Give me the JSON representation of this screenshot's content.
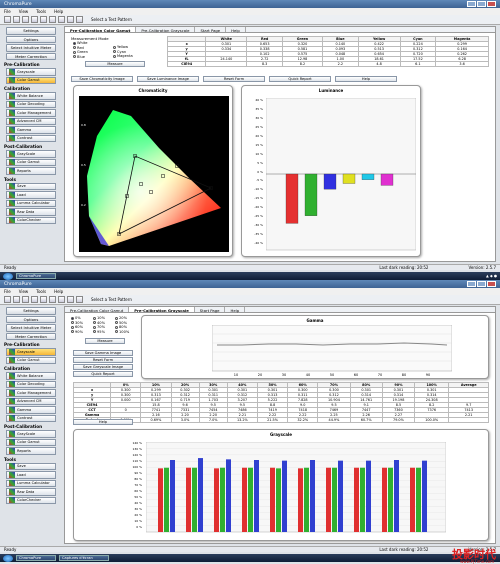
{
  "app_title": "ChromaPure",
  "menu": [
    "File",
    "View",
    "Tools",
    "Help"
  ],
  "test_pattern_label": "Select a Test Pattern",
  "sidebar": {
    "top_buttons": [
      "Settings",
      "Options",
      "Select Intuitive Meter",
      "Meter Correction"
    ],
    "sections": [
      {
        "head": "Pre-Calibration",
        "items": [
          "Grayscale",
          "Color Gamut"
        ]
      },
      {
        "head": "Calibration",
        "items": [
          "White Balance",
          "Color Decoding",
          "Color Management",
          "Advanced CM",
          "Gamma",
          "Contrast"
        ]
      },
      {
        "head": "Post-Calibration",
        "items": [
          "GrayScale",
          "Color Gamut",
          "Reports"
        ]
      },
      {
        "head": "Tools",
        "items": [
          "Save",
          "Load",
          "Lumma Calculator",
          "Raw Data",
          "ColorChecker"
        ]
      }
    ]
  },
  "win1": {
    "tabs": [
      "Pre-Calibration Color Gamut",
      "Pre-Calibration Grayscale",
      "Start Page",
      "Help"
    ],
    "measurement_mode_label": "Measurement Mode",
    "radios": [
      "White",
      "Red",
      "Green",
      "Blue",
      "Yellow",
      "Cyan",
      "Magenta"
    ],
    "measure_label": "Measure",
    "buttons": [
      "Save Chromaticity Image",
      "Save Luminance Image",
      "Reset Form",
      "Quick Report",
      "Help"
    ],
    "table": {
      "headers": [
        "",
        "White",
        "Red",
        "Green",
        "Blue",
        "Yellow",
        "Cyan",
        "Magenta"
      ],
      "rows": [
        [
          "x",
          "0.301",
          "0.653",
          "0.320",
          "0.140",
          "0.422",
          "0.224",
          "0.299"
        ],
        [
          "y",
          "0.334",
          "0.338",
          "0.581",
          "0.093",
          "0.513",
          "0.312",
          "0.164"
        ],
        [
          "Y",
          "",
          "0.102",
          "0.575",
          "0.048",
          "0.654",
          "0.720",
          "0.262"
        ],
        [
          "fL",
          "24.140",
          "2.72",
          "12.98",
          "1.00",
          "18.61",
          "17.52",
          "6.28"
        ],
        [
          "CIE94",
          "",
          "8.3",
          "8.2",
          "2.2",
          "4.8",
          "6.1",
          "3.6"
        ]
      ]
    },
    "chroma_title": "Chromaticity",
    "luminance_title": "Luminance",
    "lum_ticks": [
      "40 %",
      "35 %",
      "30 %",
      "25 %",
      "20 %",
      "15 %",
      "10 %",
      "5 %",
      "0 %",
      "-5 %",
      "-10 %",
      "-15 %",
      "-20 %",
      "-25 %",
      "-30 %",
      "-35 %",
      "-40 %"
    ],
    "status_left": "Ready",
    "status_mid": "Last dark reading: 20:52",
    "status_right": "Version: 2.5.7"
  },
  "lum_data": [
    {
      "color": "#e53030",
      "value": -26
    },
    {
      "color": "#30b030",
      "value": -22
    },
    {
      "color": "#3030e0",
      "value": -8
    },
    {
      "color": "#e0e020",
      "value": -5
    },
    {
      "color": "#20c8e8",
      "value": -3
    },
    {
      "color": "#e030d0",
      "value": -6
    }
  ],
  "win2": {
    "tabs": [
      "Pre-Calibration Color Gamut",
      "Pre-Calibration Grayscale",
      "Start Page",
      "Help"
    ],
    "radios": [
      "0%",
      "10%",
      "20%",
      "30%",
      "40%",
      "50%",
      "60%",
      "70%",
      "80%",
      "90%",
      "95%",
      "100%"
    ],
    "measure_label": "Measure",
    "buttons": [
      "Save Gamma Image",
      "Reset Form",
      "Save Greyscale Image",
      "Quick Report",
      "Help"
    ],
    "gamma_title": "Gamma",
    "gamma_ticks": [
      "10",
      "20",
      "30",
      "40",
      "50",
      "60",
      "70",
      "80",
      "90"
    ],
    "table": {
      "headers": [
        "",
        "0%",
        "10%",
        "20%",
        "30%",
        "40%",
        "50%",
        "60%",
        "70%",
        "80%",
        "90%",
        "100%",
        "Average"
      ],
      "rows": [
        [
          "x",
          "0.300",
          "0.299",
          "0.302",
          "0.301",
          "0.301",
          "0.301",
          "0.300",
          "0.300",
          "0.301",
          "0.301",
          "0.301",
          ""
        ],
        [
          "y",
          "0.300",
          "0.313",
          "0.312",
          "0.311",
          "0.312",
          "0.313",
          "0.311",
          "0.312",
          "0.314",
          "0.314",
          "0.314",
          ""
        ],
        [
          "Y",
          "0.000",
          "0.167",
          "0.719",
          "1.703",
          "3.207",
          "5.222",
          "7.828",
          "10.904",
          "14.761",
          "19.198",
          "24.308",
          ""
        ],
        [
          "CIE94",
          "",
          "15.8",
          "9.6",
          "9.5",
          "9.5",
          "8.8",
          "9.0",
          "9.5",
          "9.1",
          "8.5",
          "8.2",
          "9.7"
        ],
        [
          "CCT",
          "0",
          "7741",
          "7331",
          "7454",
          "7486",
          "7419",
          "7418",
          "7469",
          "7447",
          "7360",
          "7376",
          "7413"
        ],
        [
          "Gamma",
          "",
          "2.16",
          "2.20",
          "2.20",
          "2.21",
          "2.22",
          "2.22",
          "2.25",
          "2.26",
          "2.27",
          "",
          "2.21"
        ],
        [
          "Output",
          "0.00%",
          "0.69%",
          "3.0%",
          "7.0%",
          "13.2%",
          "21.5%",
          "32.2%",
          "44.9%",
          "60.7%",
          "79.0%",
          "100.0%",
          ""
        ]
      ]
    },
    "grayscale_title": "Grayscale",
    "gs_ticks": [
      "140 %",
      "130 %",
      "120 %",
      "110 %",
      "100 %",
      "90 %",
      "80 %",
      "70 %",
      "60 %",
      "50 %",
      "40 %",
      "30 %",
      "20 %",
      "10 %",
      "0 %"
    ],
    "status_left": "Ready",
    "status_mid": "Last dark reading: 20:52",
    "status_right": "Version: 2.5.7"
  },
  "grayscale_data": [
    {
      "r": 99,
      "g": 100,
      "b": 112
    },
    {
      "r": 100,
      "g": 100,
      "b": 115
    },
    {
      "r": 99,
      "g": 100,
      "b": 113
    },
    {
      "r": 100,
      "g": 100,
      "b": 112
    },
    {
      "r": 100,
      "g": 99,
      "b": 111
    },
    {
      "r": 99,
      "g": 100,
      "b": 112
    },
    {
      "r": 100,
      "g": 100,
      "b": 111
    },
    {
      "r": 100,
      "g": 100,
      "b": 111
    },
    {
      "r": 100,
      "g": 100,
      "b": 112
    },
    {
      "r": 100,
      "g": 100,
      "b": 111
    }
  ],
  "taskbar": {
    "items": [
      "ChromaPure",
      "ChromaPure",
      "Captures d'écran"
    ]
  },
  "watermark": {
    "text": "投影时代",
    "url": "www.PjTime.com"
  }
}
